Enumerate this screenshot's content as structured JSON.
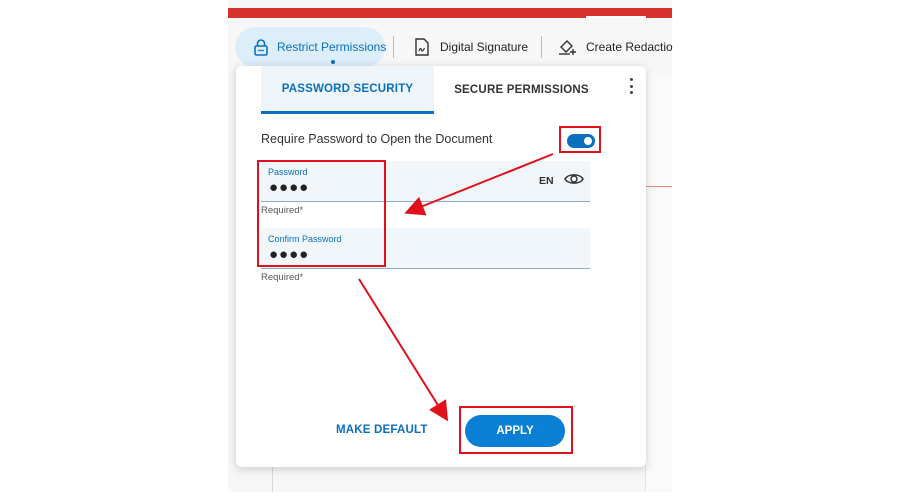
{
  "toolbar": {
    "restrict_permissions": "Restrict Permissions",
    "digital_signature": "Digital Signature",
    "create_redaction": "Create Redactio"
  },
  "panel": {
    "tabs": [
      {
        "label": "PASSWORD SECURITY",
        "active": true
      },
      {
        "label": "SECURE PERMISSIONS",
        "active": false
      }
    ],
    "require_password_label": "Require Password to Open the Document",
    "require_password_enabled": true,
    "password": {
      "label": "Password",
      "value": "●●●●",
      "language": "EN",
      "helper": "Required*"
    },
    "confirm_password": {
      "label": "Confirm Password",
      "value": "●●●●",
      "helper": "Required*"
    },
    "make_default_label": "MAKE DEFAULT",
    "apply_label": "APPLY"
  },
  "colors": {
    "accent": "#0b6fbf",
    "annotation": "#e0111b",
    "top_bar": "#d8322f"
  },
  "icons": [
    "lock-icon",
    "signature-icon",
    "redaction-icon",
    "more-vert-icon",
    "eye-icon"
  ]
}
